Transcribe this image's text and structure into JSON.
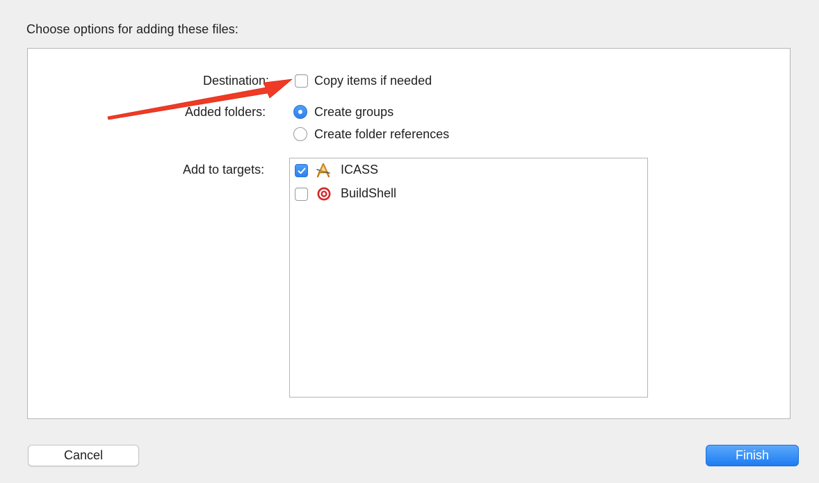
{
  "dialog": {
    "heading": "Choose options for adding these files:",
    "destination": {
      "label": "Destination:",
      "option_label": "Copy items if needed",
      "checked": false
    },
    "added_folders": {
      "label": "Added folders:",
      "options": [
        {
          "label": "Create groups",
          "selected": true
        },
        {
          "label": "Create folder references",
          "selected": false
        }
      ]
    },
    "add_to_targets": {
      "label": "Add to targets:",
      "targets": [
        {
          "name": "ICASS",
          "checked": true,
          "icon": "app-target-icon"
        },
        {
          "name": "BuildShell",
          "checked": false,
          "icon": "bullseye-target-icon"
        }
      ]
    },
    "buttons": {
      "cancel": "Cancel",
      "finish": "Finish"
    },
    "annotation": {
      "arrow_color": "#f03a25"
    },
    "colors": {
      "accent": "#2f7fee",
      "background": "#efefef"
    }
  }
}
